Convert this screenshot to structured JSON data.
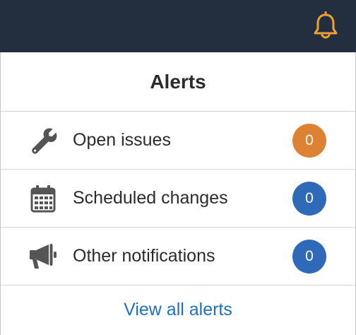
{
  "topbar": {
    "bell_icon": "bell-icon",
    "accent": "#f0a030",
    "background": "#232f3e"
  },
  "panel": {
    "title": "Alerts",
    "items": [
      {
        "label": "Open issues",
        "count": "0",
        "icon": "wrench-icon",
        "badge_color": "#dd8133"
      },
      {
        "label": "Scheduled changes",
        "count": "0",
        "icon": "calendar-icon",
        "badge_color": "#2f6ab8"
      },
      {
        "label": "Other notifications",
        "count": "0",
        "icon": "megaphone-icon",
        "badge_color": "#2f6ab8"
      }
    ],
    "view_all_label": "View all alerts"
  }
}
